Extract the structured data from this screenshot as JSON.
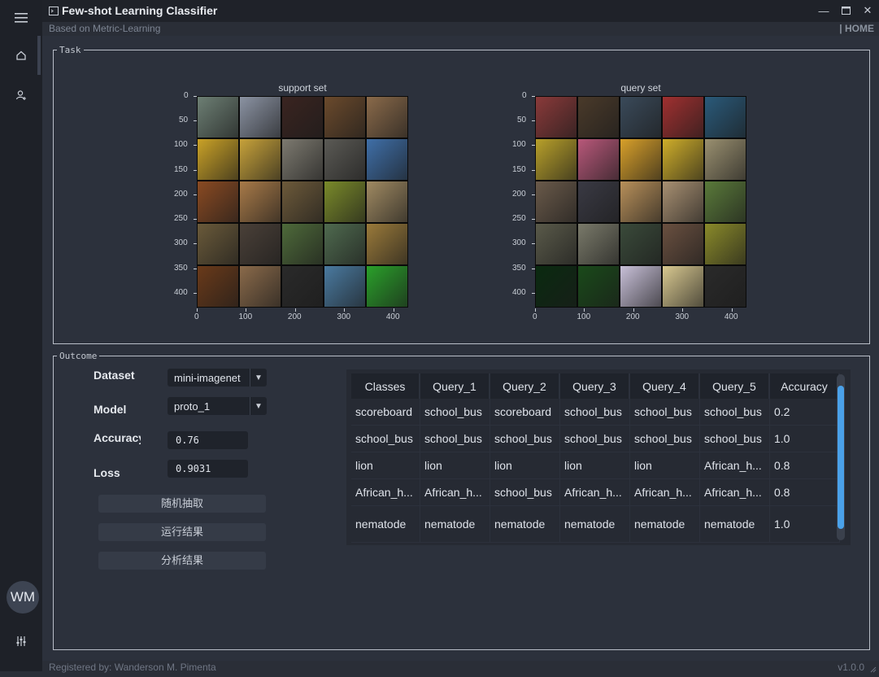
{
  "app": {
    "title": "Few-shot Learning Classifier",
    "subtitle": "Based on Metric-Learning",
    "home_label": "| HOME",
    "avatar_initials": "WM",
    "footer_left": "Registered by: Wanderson M. Pimenta",
    "footer_right": "v1.0.0"
  },
  "task": {
    "legend": "Task",
    "support_title": "support set",
    "query_title": "query set",
    "y_ticks": [
      "0",
      "50",
      "100",
      "150",
      "200",
      "250",
      "300",
      "350",
      "400"
    ],
    "x_ticks": [
      "0",
      "100",
      "200",
      "300",
      "400"
    ]
  },
  "outcome": {
    "legend": "Outcome",
    "dataset_label": "Dataset",
    "dataset_value": "mini-imagenet",
    "model_label": "Model",
    "model_value": "proto_1",
    "accuracy_label": "Accuracy",
    "accuracy_value": "0.76",
    "loss_label": "Loss",
    "loss_value": "0.9031",
    "btn_sample": "随机抽取",
    "btn_run": "运行结果",
    "btn_analyze": "分析结果"
  },
  "results_table": {
    "headers": [
      "Classes",
      "Query_1",
      "Query_2",
      "Query_3",
      "Query_4",
      "Query_5",
      "Accuracy"
    ],
    "rows": [
      [
        "scoreboard",
        "school_bus",
        "scoreboard",
        "school_bus",
        "school_bus",
        "school_bus",
        "0.2"
      ],
      [
        "school_bus",
        "school_bus",
        "school_bus",
        "school_bus",
        "school_bus",
        "school_bus",
        "1.0"
      ],
      [
        "lion",
        "lion",
        "lion",
        "lion",
        "lion",
        "African_h...",
        "0.8"
      ],
      [
        "African_h...",
        "African_h...",
        "school_bus",
        "African_h...",
        "African_h...",
        "African_h...",
        "0.8"
      ],
      [
        "nematode",
        "nematode",
        "nematode",
        "nematode",
        "nematode",
        "nematode",
        "1.0"
      ]
    ]
  },
  "colors": {
    "accent": "#4aa1e9",
    "support_tiles": [
      [
        "#6d7f74",
        "#8b93a3",
        "#3a2420",
        "#6b4a2c",
        "#8a6a4a"
      ],
      [
        "#caa227",
        "#c7a23a",
        "#7d7a70",
        "#5b5a55",
        "#3f6fa8"
      ],
      [
        "#8a4a22",
        "#a87a48",
        "#6d5a3a",
        "#7a8a2a",
        "#a08a62"
      ],
      [
        "#6a5a3a",
        "#4a4038",
        "#4e6a3a",
        "#4f6a4f",
        "#9a7a3a"
      ],
      [
        "#6a3a1a",
        "#8a6a4a",
        "#2a2a2a",
        "#4a7aa0",
        "#2aa02a"
      ]
    ],
    "query_tiles": [
      [
        "#8a3a3a",
        "#4a3a2a",
        "#3a4a5a",
        "#a03030",
        "#2a5a7a"
      ],
      [
        "#b8a02a",
        "#b8587a",
        "#d8a02a",
        "#cfae2a",
        "#9a9070"
      ],
      [
        "#6a5a4a",
        "#3a3a44",
        "#b8905a",
        "#a89072",
        "#5a7a3a"
      ],
      [
        "#5a5a4a",
        "#7a7a6a",
        "#3a4a3a",
        "#6a5040",
        "#8a8a2a"
      ],
      [
        "#0a2a10",
        "#1a4a1a",
        "#c8c0d8",
        "#d8c890",
        "#2a2a2a"
      ]
    ]
  }
}
